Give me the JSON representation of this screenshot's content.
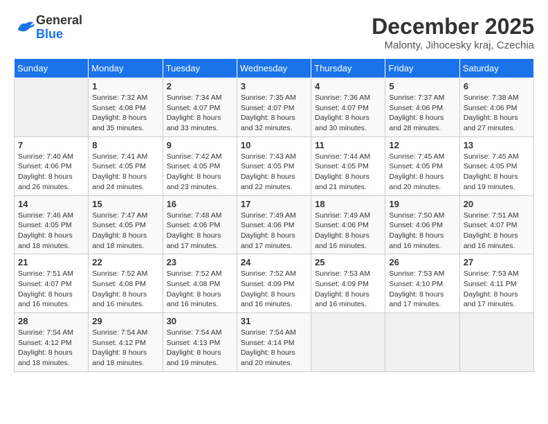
{
  "logo": {
    "general": "General",
    "blue": "Blue"
  },
  "header": {
    "month": "December 2025",
    "location": "Malonty, Jihocesky kraj, Czechia"
  },
  "weekdays": [
    "Sunday",
    "Monday",
    "Tuesday",
    "Wednesday",
    "Thursday",
    "Friday",
    "Saturday"
  ],
  "weeks": [
    [
      {
        "day": "",
        "info": ""
      },
      {
        "day": "1",
        "info": "Sunrise: 7:32 AM\nSunset: 4:08 PM\nDaylight: 8 hours\nand 35 minutes."
      },
      {
        "day": "2",
        "info": "Sunrise: 7:34 AM\nSunset: 4:07 PM\nDaylight: 8 hours\nand 33 minutes."
      },
      {
        "day": "3",
        "info": "Sunrise: 7:35 AM\nSunset: 4:07 PM\nDaylight: 8 hours\nand 32 minutes."
      },
      {
        "day": "4",
        "info": "Sunrise: 7:36 AM\nSunset: 4:07 PM\nDaylight: 8 hours\nand 30 minutes."
      },
      {
        "day": "5",
        "info": "Sunrise: 7:37 AM\nSunset: 4:06 PM\nDaylight: 8 hours\nand 28 minutes."
      },
      {
        "day": "6",
        "info": "Sunrise: 7:38 AM\nSunset: 4:06 PM\nDaylight: 8 hours\nand 27 minutes."
      }
    ],
    [
      {
        "day": "7",
        "info": "Sunrise: 7:40 AM\nSunset: 4:06 PM\nDaylight: 8 hours\nand 26 minutes."
      },
      {
        "day": "8",
        "info": "Sunrise: 7:41 AM\nSunset: 4:05 PM\nDaylight: 8 hours\nand 24 minutes."
      },
      {
        "day": "9",
        "info": "Sunrise: 7:42 AM\nSunset: 4:05 PM\nDaylight: 8 hours\nand 23 minutes."
      },
      {
        "day": "10",
        "info": "Sunrise: 7:43 AM\nSunset: 4:05 PM\nDaylight: 8 hours\nand 22 minutes."
      },
      {
        "day": "11",
        "info": "Sunrise: 7:44 AM\nSunset: 4:05 PM\nDaylight: 8 hours\nand 21 minutes."
      },
      {
        "day": "12",
        "info": "Sunrise: 7:45 AM\nSunset: 4:05 PM\nDaylight: 8 hours\nand 20 minutes."
      },
      {
        "day": "13",
        "info": "Sunrise: 7:45 AM\nSunset: 4:05 PM\nDaylight: 8 hours\nand 19 minutes."
      }
    ],
    [
      {
        "day": "14",
        "info": "Sunrise: 7:46 AM\nSunset: 4:05 PM\nDaylight: 8 hours\nand 18 minutes."
      },
      {
        "day": "15",
        "info": "Sunrise: 7:47 AM\nSunset: 4:05 PM\nDaylight: 8 hours\nand 18 minutes."
      },
      {
        "day": "16",
        "info": "Sunrise: 7:48 AM\nSunset: 4:06 PM\nDaylight: 8 hours\nand 17 minutes."
      },
      {
        "day": "17",
        "info": "Sunrise: 7:49 AM\nSunset: 4:06 PM\nDaylight: 8 hours\nand 17 minutes."
      },
      {
        "day": "18",
        "info": "Sunrise: 7:49 AM\nSunset: 4:06 PM\nDaylight: 8 hours\nand 16 minutes."
      },
      {
        "day": "19",
        "info": "Sunrise: 7:50 AM\nSunset: 4:06 PM\nDaylight: 8 hours\nand 16 minutes."
      },
      {
        "day": "20",
        "info": "Sunrise: 7:51 AM\nSunset: 4:07 PM\nDaylight: 8 hours\nand 16 minutes."
      }
    ],
    [
      {
        "day": "21",
        "info": "Sunrise: 7:51 AM\nSunset: 4:07 PM\nDaylight: 8 hours\nand 16 minutes."
      },
      {
        "day": "22",
        "info": "Sunrise: 7:52 AM\nSunset: 4:08 PM\nDaylight: 8 hours\nand 16 minutes."
      },
      {
        "day": "23",
        "info": "Sunrise: 7:52 AM\nSunset: 4:08 PM\nDaylight: 8 hours\nand 16 minutes."
      },
      {
        "day": "24",
        "info": "Sunrise: 7:52 AM\nSunset: 4:09 PM\nDaylight: 8 hours\nand 16 minutes."
      },
      {
        "day": "25",
        "info": "Sunrise: 7:53 AM\nSunset: 4:09 PM\nDaylight: 8 hours\nand 16 minutes."
      },
      {
        "day": "26",
        "info": "Sunrise: 7:53 AM\nSunset: 4:10 PM\nDaylight: 8 hours\nand 17 minutes."
      },
      {
        "day": "27",
        "info": "Sunrise: 7:53 AM\nSunset: 4:11 PM\nDaylight: 8 hours\nand 17 minutes."
      }
    ],
    [
      {
        "day": "28",
        "info": "Sunrise: 7:54 AM\nSunset: 4:12 PM\nDaylight: 8 hours\nand 18 minutes."
      },
      {
        "day": "29",
        "info": "Sunrise: 7:54 AM\nSunset: 4:12 PM\nDaylight: 8 hours\nand 18 minutes."
      },
      {
        "day": "30",
        "info": "Sunrise: 7:54 AM\nSunset: 4:13 PM\nDaylight: 8 hours\nand 19 minutes."
      },
      {
        "day": "31",
        "info": "Sunrise: 7:54 AM\nSunset: 4:14 PM\nDaylight: 8 hours\nand 20 minutes."
      },
      {
        "day": "",
        "info": ""
      },
      {
        "day": "",
        "info": ""
      },
      {
        "day": "",
        "info": ""
      }
    ]
  ]
}
